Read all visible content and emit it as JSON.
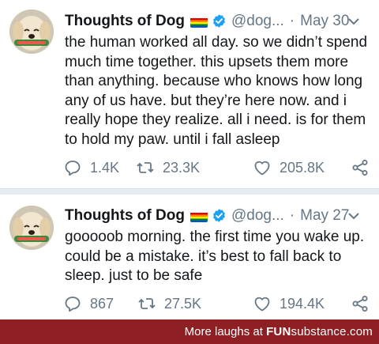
{
  "tweets": [
    {
      "author": "Thoughts of Dog",
      "handle": "@dog...",
      "separator": "·",
      "date": "May 30",
      "text": "the human worked all day. so we didn’t spend\nmuch time together. this upsets them more\nthan anything. because who knows how long\nany of us have. but they’re here now. and i\nreally hope they realize. all i need. is for them\nto hold my paw. until i fall asleep",
      "replies": "1.4K",
      "retweets": "23.3K",
      "likes": "205.8K"
    },
    {
      "author": "Thoughts of Dog",
      "handle": "@dog...",
      "separator": "·",
      "date": "May 27",
      "text": "gooooob morning. the first time you wake up.\ncould be a mistake. it’s best to fall back to\nsleep. just to be safe",
      "replies": "867",
      "retweets": "27.5K",
      "likes": "194.4K"
    }
  ],
  "icons": {
    "reply": "reply-icon",
    "retweet": "retweet-icon",
    "like": "heart-icon",
    "share": "share-icon",
    "verified": "verified-badge-icon",
    "flag": "rainbow-flag-icon",
    "caret": "chevron-down-icon"
  },
  "colors": {
    "text": "#14171a",
    "muted": "#657786",
    "verified": "#1da1f2",
    "footer_bg": "#8e1f22"
  },
  "footer": {
    "label": "More laughs at",
    "site_main": "FUN",
    "site_sub": "substance",
    "site_tld": ".com"
  }
}
